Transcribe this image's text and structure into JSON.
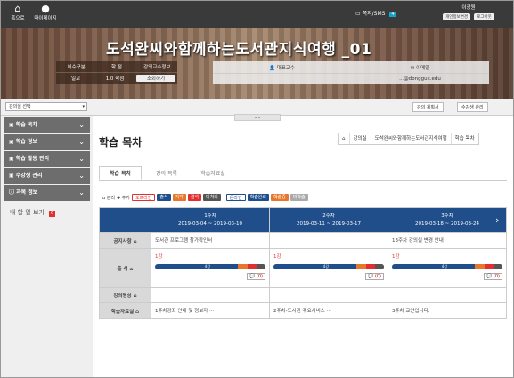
{
  "topbar": {
    "home_label": "홈으로",
    "mypage_label": "마이페이지",
    "sms_label": "쪽지/SMS",
    "sms_count": "4",
    "user_name": "이광원",
    "user_btn1": "개인정보변경",
    "user_btn2": "로그아웃"
  },
  "course": {
    "title": "도석완씨와함께하는도서관지식여행 _01",
    "info": [
      {
        "label": "이수구분",
        "value": "학 점",
        "extra": "강의교수정보"
      },
      {
        "label": "일교",
        "value": "1.0 학점",
        "extra": "조회하기"
      }
    ],
    "prof_label": "대표교수",
    "prof_name": "",
    "email_label": "이메일",
    "email_value": "...@dongguk.edu"
  },
  "subbar": {
    "select_label": "강의실 선택",
    "btn_plan": "강의 계획서",
    "btn_manage": "수강생 관리"
  },
  "sidebar": {
    "items": [
      {
        "label": "학습 목차"
      },
      {
        "label": "학습 정보"
      },
      {
        "label": "학습 활동 관리"
      },
      {
        "label": "수강생 관리"
      },
      {
        "label": "과목 정보"
      }
    ],
    "mynote_label": "내 할 일 보기",
    "mynote_count": "0"
  },
  "main": {
    "page_title": "학습 목차",
    "breadcrumb": [
      "⌂",
      "강의실",
      "도석완씨와함께하는도서관지식여행",
      "학습 목차"
    ],
    "tabs": [
      {
        "label": "학습 목차"
      },
      {
        "label": "강의 목록"
      },
      {
        "label": "학습자료실"
      }
    ],
    "legend": {
      "manage": "관리",
      "add": "추가",
      "offline": "오프라인",
      "states": [
        "출석",
        "지각",
        "결석",
        "미처리"
      ],
      "online": "온라인",
      "online_states": [
        "학습완료",
        "학습중",
        "미학습"
      ]
    },
    "weeks": [
      {
        "name": "1주차",
        "range": "2019-03-04 ~ 2019-03-10",
        "notice": "도서관 프로그램 참가확인서",
        "lesson": "1강",
        "progress": "4강",
        "comment": "(0)",
        "material": "1주차강좌 안내 및 정보자 ···"
      },
      {
        "name": "2주차",
        "range": "2019-03-11 ~ 2019-03-17",
        "notice": "",
        "lesson": "1강",
        "progress": "4강",
        "comment": "(0)",
        "material": "2주차-도서관 주요서비스 ···"
      },
      {
        "name": "3주차",
        "range": "2019-03-18 ~ 2019-03-24",
        "notice": "13주차 강의실 변경 안내",
        "lesson": "1강",
        "progress": "4강",
        "comment": "(0)",
        "material": "3주차 교안입니다."
      }
    ],
    "rows": {
      "notice": "공지사항",
      "attendance": "출 석",
      "quiz": "강의평상",
      "material": "학습자료실"
    }
  },
  "colors": {
    "topbar": "#3a3a3a",
    "grid_header": "#1f4e8a",
    "orange": "#e8772e",
    "red": "#e03030"
  }
}
